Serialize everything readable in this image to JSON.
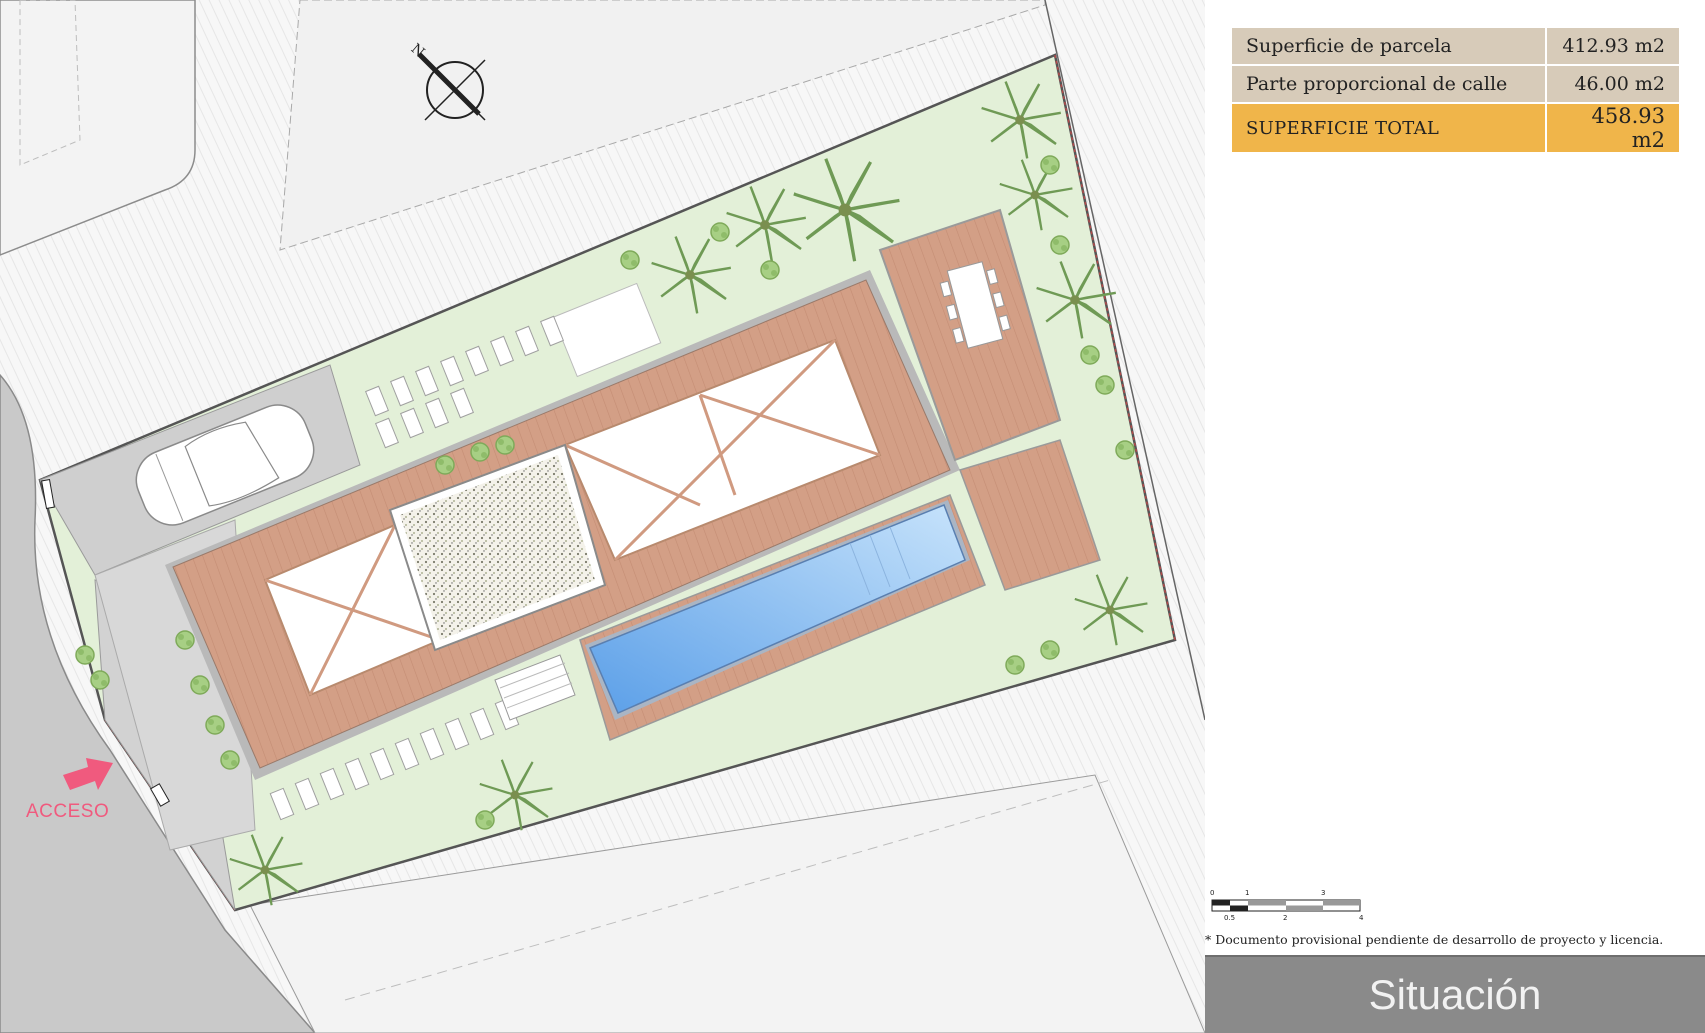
{
  "area_table": {
    "rows": [
      {
        "label": "Superficie de parcela",
        "value": "412.93 m2"
      },
      {
        "label": "Parte proporcional de calle",
        "value": "46.00 m2"
      }
    ],
    "total": {
      "label": "SUPERFICIE TOTAL",
      "value": "458.93 m2"
    }
  },
  "plan": {
    "north_label": "N",
    "access_label": "ACCESO"
  },
  "scale_bar": {
    "top_ticks": [
      "0",
      "1",
      "3"
    ],
    "bottom_ticks": [
      "0.5",
      "2",
      "4"
    ]
  },
  "disclaimer": "* Documento provisional pendiente de desarrollo de proyecto y licencia.",
  "title": "Situación",
  "colors": {
    "table_row": "#d7cbb9",
    "table_total": "#f0b54a",
    "garden": "#e3f0d8",
    "deck": "#d29e84",
    "pool": "#7db6ef",
    "road": "#c9c9c9",
    "access": "#f05a7e",
    "title_band": "#8a8a8a"
  }
}
